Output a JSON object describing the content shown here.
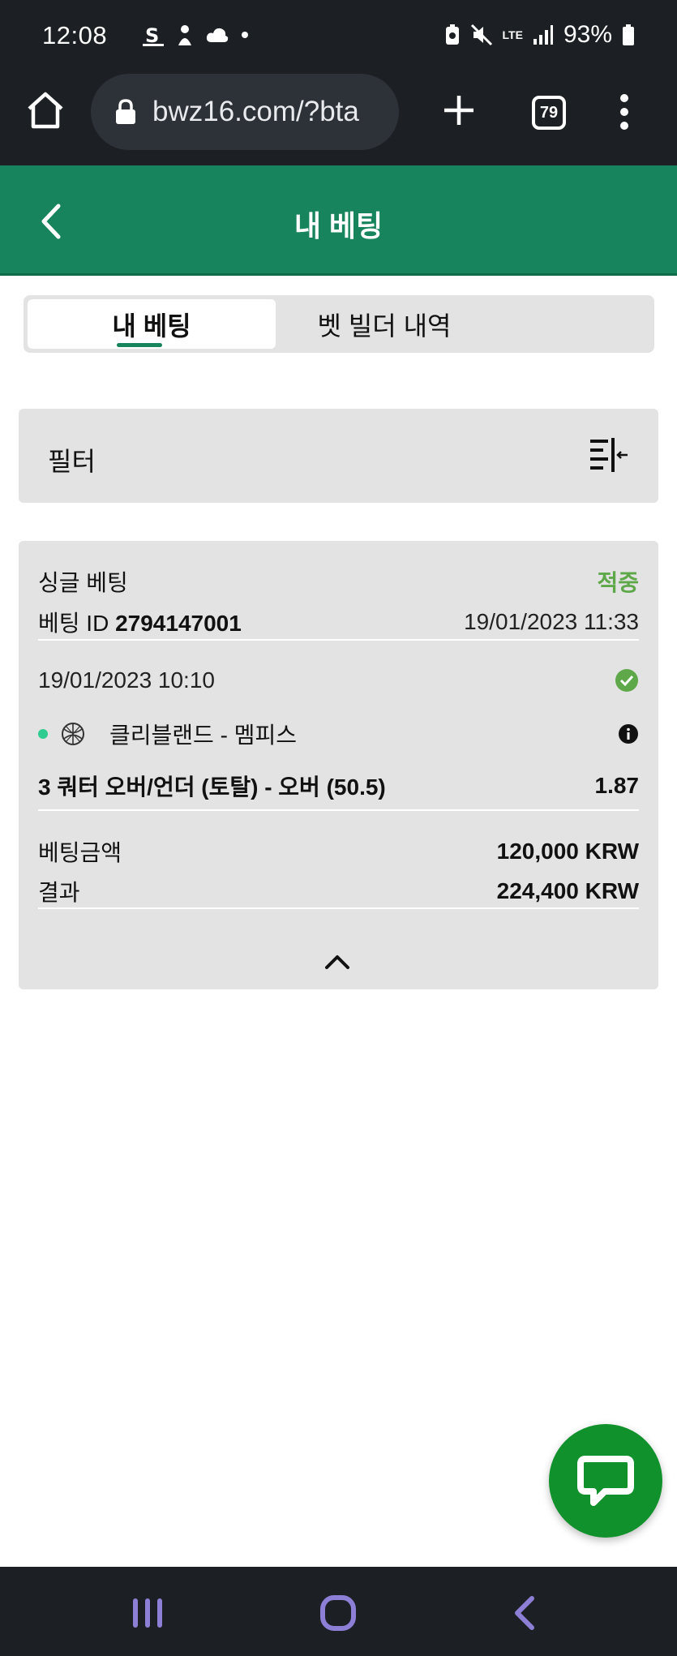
{
  "status_bar": {
    "time": "12:08",
    "battery": "93%",
    "network": "LTE"
  },
  "browser": {
    "url": "bwz16.com/?bta",
    "tab_count": "79"
  },
  "header": {
    "title": "내 베팅"
  },
  "tabs": [
    {
      "label": "내 베팅",
      "active": true
    },
    {
      "label": "벳 빌더 내역",
      "active": false
    }
  ],
  "filter": {
    "label": "필터"
  },
  "bet": {
    "type": "싱글 베팅",
    "status": "적중",
    "id_label": "베팅 ID ",
    "id_value": "2794147001",
    "placed_at": "19/01/2023 11:33",
    "event_time": "19/01/2023 10:10",
    "match": "클리블랜드 - 멤피스",
    "selection": "3 쿼터 오버/언더 (토탈) - 오버 (50.5)",
    "odds": "1.87",
    "stake_label": "베팅금액",
    "stake_value": "120,000 KRW",
    "result_label": "결과",
    "result_value": "224,400 KRW"
  },
  "colors": {
    "brand_green": "#18845e",
    "win_green": "#5ea84a",
    "chat_green": "#10912b"
  },
  "icons": [
    "home-icon",
    "lock-icon",
    "plus-icon",
    "tabs-icon",
    "menu-icon",
    "back-icon",
    "filter-icon",
    "check-circle-icon",
    "basketball-icon",
    "info-icon",
    "chevron-up-icon",
    "chat-icon"
  ]
}
